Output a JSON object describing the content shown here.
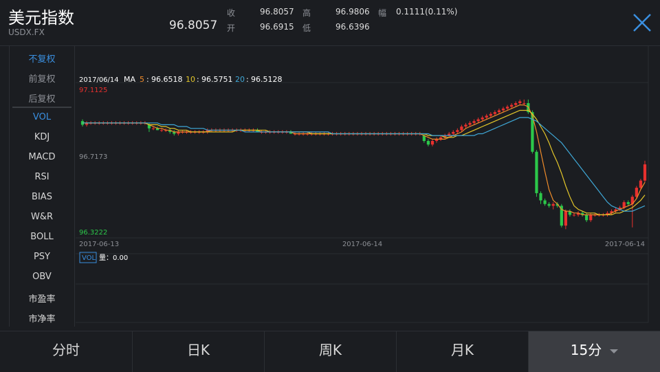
{
  "header": {
    "title": "美元指数",
    "code": "USDX.FX",
    "price": "96.8057",
    "quotes": [
      {
        "label": "收",
        "value": "96.8057"
      },
      {
        "label": "开",
        "value": "96.6915"
      },
      {
        "label": "高",
        "value": "96.9806"
      },
      {
        "label": "低",
        "value": "96.6396"
      },
      {
        "label": "幅",
        "value": "0.1111(0.11%)"
      }
    ]
  },
  "sidebar": {
    "adjust": [
      "不复权",
      "前复权",
      "后复权"
    ],
    "indicators": [
      "VOL",
      "KDJ",
      "MACD",
      "RSI",
      "BIAS",
      "W&R",
      "BOLL",
      "PSY",
      "OBV",
      "市盈率",
      "市净率"
    ]
  },
  "ma_legend": {
    "date": "2017/06/14",
    "label": "MA",
    "items": [
      {
        "key": "5",
        "value": "96.6518",
        "color": "#f08c2a"
      },
      {
        "key": "10",
        "value": "96.5751",
        "color": "#e4c72a"
      },
      {
        "key": "20",
        "value": "96.5128",
        "color": "#3fa7d6"
      }
    ]
  },
  "vol_legend": {
    "tag": "VOL",
    "text": "量：0.00"
  },
  "tabs": [
    "分时",
    "日K",
    "周K",
    "月K",
    "15分"
  ],
  "colors": {
    "up": "#e8302e",
    "down": "#2cc84a",
    "ma5": "#f08c2a",
    "ma10": "#e4c72a",
    "ma20": "#3fa7d6",
    "accent": "#3a8fe0"
  },
  "chart_data": {
    "type": "candlestick",
    "y_axis_labels": [
      "97.1125",
      "96.7173",
      "96.3222"
    ],
    "x_axis_labels": [
      "2017-06-13",
      "2017-06-14",
      "2017-06-14"
    ],
    "ylim": [
      96.3222,
      97.1125
    ],
    "candles": [
      [
        96.94,
        96.95,
        96.91,
        96.92
      ],
      [
        96.92,
        96.94,
        96.91,
        96.93
      ],
      [
        96.93,
        96.94,
        96.92,
        96.93
      ],
      [
        96.93,
        96.94,
        96.92,
        96.93
      ],
      [
        96.93,
        96.94,
        96.92,
        96.93
      ],
      [
        96.93,
        96.94,
        96.92,
        96.93
      ],
      [
        96.93,
        96.94,
        96.92,
        96.93
      ],
      [
        96.93,
        96.94,
        96.92,
        96.93
      ],
      [
        96.93,
        96.94,
        96.92,
        96.93
      ],
      [
        96.93,
        96.94,
        96.92,
        96.93
      ],
      [
        96.93,
        96.94,
        96.92,
        96.93
      ],
      [
        96.93,
        96.94,
        96.92,
        96.93
      ],
      [
        96.93,
        96.94,
        96.92,
        96.93
      ],
      [
        96.93,
        96.94,
        96.92,
        96.93
      ],
      [
        96.93,
        96.94,
        96.92,
        96.93
      ],
      [
        96.93,
        96.94,
        96.92,
        96.93
      ],
      [
        96.92,
        96.93,
        96.88,
        96.9
      ],
      [
        96.9,
        96.91,
        96.89,
        96.9
      ],
      [
        96.9,
        96.91,
        96.89,
        96.89
      ],
      [
        96.89,
        96.9,
        96.88,
        96.89
      ],
      [
        96.89,
        96.9,
        96.88,
        96.89
      ],
      [
        96.89,
        96.9,
        96.87,
        96.88
      ],
      [
        96.88,
        96.89,
        96.86,
        96.87
      ],
      [
        96.87,
        96.89,
        96.86,
        96.88
      ],
      [
        96.88,
        96.89,
        96.87,
        96.88
      ],
      [
        96.88,
        96.89,
        96.87,
        96.88
      ],
      [
        96.88,
        96.89,
        96.87,
        96.88
      ],
      [
        96.88,
        96.89,
        96.87,
        96.88
      ],
      [
        96.88,
        96.89,
        96.87,
        96.88
      ],
      [
        96.88,
        96.89,
        96.87,
        96.88
      ],
      [
        96.88,
        96.9,
        96.87,
        96.89
      ],
      [
        96.89,
        96.9,
        96.88,
        96.89
      ],
      [
        96.89,
        96.9,
        96.88,
        96.89
      ],
      [
        96.89,
        96.9,
        96.88,
        96.89
      ],
      [
        96.89,
        96.9,
        96.88,
        96.89
      ],
      [
        96.89,
        96.9,
        96.88,
        96.89
      ],
      [
        96.89,
        96.9,
        96.88,
        96.89
      ],
      [
        96.89,
        96.9,
        96.88,
        96.89
      ],
      [
        96.89,
        96.9,
        96.88,
        96.89
      ],
      [
        96.89,
        96.9,
        96.88,
        96.89
      ],
      [
        96.89,
        96.9,
        96.88,
        96.89
      ],
      [
        96.89,
        96.9,
        96.88,
        96.89
      ],
      [
        96.89,
        96.9,
        96.88,
        96.88
      ],
      [
        96.88,
        96.89,
        96.87,
        96.88
      ],
      [
        96.88,
        96.89,
        96.87,
        96.88
      ],
      [
        96.88,
        96.89,
        96.87,
        96.88
      ],
      [
        96.88,
        96.89,
        96.87,
        96.88
      ],
      [
        96.88,
        96.89,
        96.87,
        96.88
      ],
      [
        96.88,
        96.89,
        96.87,
        96.88
      ],
      [
        96.88,
        96.89,
        96.87,
        96.88
      ],
      [
        96.88,
        96.89,
        96.87,
        96.87
      ],
      [
        96.87,
        96.88,
        96.86,
        96.87
      ],
      [
        96.87,
        96.88,
        96.86,
        96.87
      ],
      [
        96.87,
        96.88,
        96.86,
        96.87
      ],
      [
        96.87,
        96.88,
        96.86,
        96.87
      ],
      [
        96.87,
        96.88,
        96.86,
        96.87
      ],
      [
        96.87,
        96.88,
        96.86,
        96.87
      ],
      [
        96.87,
        96.88,
        96.86,
        96.87
      ],
      [
        96.87,
        96.88,
        96.86,
        96.87
      ],
      [
        96.87,
        96.88,
        96.86,
        96.87
      ],
      [
        96.87,
        96.88,
        96.86,
        96.87
      ],
      [
        96.87,
        96.88,
        96.86,
        96.87
      ],
      [
        96.87,
        96.88,
        96.86,
        96.87
      ],
      [
        96.87,
        96.88,
        96.86,
        96.87
      ],
      [
        96.87,
        96.88,
        96.86,
        96.87
      ],
      [
        96.87,
        96.88,
        96.86,
        96.87
      ],
      [
        96.87,
        96.88,
        96.86,
        96.87
      ],
      [
        96.87,
        96.88,
        96.86,
        96.87
      ],
      [
        96.87,
        96.88,
        96.86,
        96.87
      ],
      [
        96.87,
        96.88,
        96.86,
        96.87
      ],
      [
        96.87,
        96.88,
        96.86,
        96.87
      ],
      [
        96.87,
        96.88,
        96.86,
        96.87
      ],
      [
        96.87,
        96.88,
        96.86,
        96.87
      ],
      [
        96.87,
        96.88,
        96.86,
        96.87
      ],
      [
        96.87,
        96.88,
        96.86,
        96.87
      ],
      [
        96.87,
        96.88,
        96.86,
        96.87
      ],
      [
        96.87,
        96.88,
        96.86,
        96.87
      ],
      [
        96.87,
        96.88,
        96.86,
        96.87
      ],
      [
        96.87,
        96.88,
        96.86,
        96.87
      ],
      [
        96.87,
        96.88,
        96.86,
        96.87
      ],
      [
        96.87,
        96.88,
        96.86,
        96.87
      ],
      [
        96.87,
        96.88,
        96.86,
        96.87
      ],
      [
        96.86,
        96.87,
        96.82,
        96.83
      ],
      [
        96.83,
        96.84,
        96.8,
        96.81
      ],
      [
        96.81,
        96.84,
        96.8,
        96.83
      ],
      [
        96.83,
        96.85,
        96.82,
        96.84
      ],
      [
        96.84,
        96.86,
        96.83,
        96.85
      ],
      [
        96.85,
        96.87,
        96.84,
        96.86
      ],
      [
        96.86,
        96.88,
        96.85,
        96.87
      ],
      [
        96.87,
        96.89,
        96.86,
        96.88
      ],
      [
        96.88,
        96.9,
        96.87,
        96.89
      ],
      [
        96.89,
        96.92,
        96.88,
        96.91
      ],
      [
        96.91,
        96.93,
        96.9,
        96.92
      ],
      [
        96.92,
        96.94,
        96.91,
        96.93
      ],
      [
        96.93,
        96.95,
        96.92,
        96.94
      ],
      [
        96.94,
        96.96,
        96.93,
        96.95
      ],
      [
        96.95,
        96.97,
        96.94,
        96.96
      ],
      [
        96.96,
        96.98,
        96.95,
        96.97
      ],
      [
        96.97,
        96.99,
        96.96,
        96.98
      ],
      [
        96.98,
        97.0,
        96.97,
        96.99
      ],
      [
        96.99,
        97.01,
        96.98,
        97.0
      ],
      [
        97.0,
        97.02,
        96.99,
        97.01
      ],
      [
        97.01,
        97.03,
        97.0,
        97.02
      ],
      [
        97.02,
        97.04,
        97.01,
        97.03
      ],
      [
        97.03,
        97.05,
        97.02,
        97.04
      ],
      [
        97.04,
        97.06,
        97.03,
        97.05
      ],
      [
        97.04,
        97.06,
        97.03,
        97.04
      ],
      [
        97.04,
        97.06,
        96.98,
        96.99
      ],
      [
        96.99,
        97.0,
        96.76,
        96.77
      ],
      [
        96.77,
        96.78,
        96.52,
        96.54
      ],
      [
        96.54,
        96.55,
        96.48,
        96.5
      ],
      [
        96.5,
        96.51,
        96.47,
        96.48
      ],
      [
        96.48,
        96.49,
        96.46,
        96.47
      ],
      [
        96.47,
        96.49,
        96.45,
        96.48
      ],
      [
        96.48,
        96.49,
        96.46,
        96.47
      ],
      [
        96.47,
        96.48,
        96.35,
        96.36
      ],
      [
        96.36,
        96.45,
        96.34,
        96.44
      ],
      [
        96.44,
        96.45,
        96.41,
        96.42
      ],
      [
        96.42,
        96.43,
        96.41,
        96.42
      ],
      [
        96.42,
        96.44,
        96.41,
        96.43
      ],
      [
        96.43,
        96.44,
        96.41,
        96.42
      ],
      [
        96.42,
        96.43,
        96.38,
        96.39
      ],
      [
        96.39,
        96.43,
        96.38,
        96.42
      ],
      [
        96.42,
        96.43,
        96.41,
        96.42
      ],
      [
        96.42,
        96.43,
        96.41,
        96.42
      ],
      [
        96.42,
        96.43,
        96.41,
        96.42
      ],
      [
        96.42,
        96.44,
        96.41,
        96.43
      ],
      [
        96.43,
        96.45,
        96.42,
        96.44
      ],
      [
        96.44,
        96.46,
        96.43,
        96.45
      ],
      [
        96.45,
        96.47,
        96.44,
        96.46
      ],
      [
        96.46,
        96.5,
        96.45,
        96.49
      ],
      [
        96.49,
        96.5,
        96.47,
        96.48
      ],
      [
        96.48,
        96.53,
        96.35,
        96.52
      ],
      [
        96.52,
        96.58,
        96.51,
        96.57
      ],
      [
        96.57,
        96.62,
        96.56,
        96.61
      ],
      [
        96.61,
        96.72,
        96.6,
        96.7
      ]
    ],
    "ma_lines": [
      {
        "name": "MA5",
        "values": [
          96.93,
          96.93,
          96.93,
          96.93,
          96.93,
          96.93,
          96.93,
          96.93,
          96.93,
          96.93,
          96.93,
          96.93,
          96.93,
          96.93,
          96.93,
          96.93,
          96.92,
          96.91,
          96.9,
          96.9,
          96.89,
          96.89,
          96.88,
          96.88,
          96.88,
          96.88,
          96.88,
          96.88,
          96.88,
          96.88,
          96.88,
          96.89,
          96.89,
          96.89,
          96.89,
          96.89,
          96.89,
          96.89,
          96.89,
          96.89,
          96.89,
          96.89,
          96.89,
          96.88,
          96.88,
          96.88,
          96.88,
          96.88,
          96.88,
          96.88,
          96.88,
          96.87,
          96.87,
          96.87,
          96.87,
          96.87,
          96.87,
          96.87,
          96.87,
          96.87,
          96.87,
          96.87,
          96.87,
          96.87,
          96.87,
          96.87,
          96.87,
          96.87,
          96.87,
          96.87,
          96.87,
          96.87,
          96.87,
          96.87,
          96.87,
          96.87,
          96.87,
          96.87,
          96.87,
          96.87,
          96.87,
          96.87,
          96.86,
          96.85,
          96.84,
          96.84,
          96.84,
          96.84,
          96.85,
          96.86,
          96.87,
          96.88,
          96.9,
          96.91,
          96.92,
          96.93,
          96.94,
          96.95,
          96.96,
          96.97,
          96.98,
          96.99,
          97.0,
          97.01,
          97.02,
          97.03,
          97.03,
          97.02,
          96.97,
          96.88,
          96.77,
          96.66,
          96.56,
          96.5,
          96.48,
          96.45,
          96.44,
          96.44,
          96.43,
          96.43,
          96.42,
          96.42,
          96.42,
          96.42,
          96.42,
          96.42,
          96.42,
          96.43,
          96.44,
          96.45,
          96.46,
          96.47,
          96.48,
          96.51,
          96.56,
          96.6
        ]
      },
      {
        "name": "MA10",
        "values": [
          96.93,
          96.93,
          96.93,
          96.93,
          96.93,
          96.93,
          96.93,
          96.93,
          96.93,
          96.93,
          96.93,
          96.93,
          96.93,
          96.93,
          96.93,
          96.93,
          96.92,
          96.92,
          96.92,
          96.91,
          96.91,
          96.9,
          96.9,
          96.89,
          96.89,
          96.89,
          96.88,
          96.88,
          96.88,
          96.88,
          96.88,
          96.88,
          96.88,
          96.88,
          96.88,
          96.88,
          96.88,
          96.89,
          96.89,
          96.89,
          96.89,
          96.89,
          96.89,
          96.89,
          96.89,
          96.88,
          96.88,
          96.88,
          96.88,
          96.88,
          96.88,
          96.88,
          96.88,
          96.88,
          96.88,
          96.87,
          96.87,
          96.87,
          96.87,
          96.87,
          96.87,
          96.87,
          96.87,
          96.87,
          96.87,
          96.87,
          96.87,
          96.87,
          96.87,
          96.87,
          96.87,
          96.87,
          96.87,
          96.87,
          96.87,
          96.87,
          96.87,
          96.87,
          96.87,
          96.87,
          96.87,
          96.87,
          96.87,
          96.86,
          96.86,
          96.86,
          96.86,
          96.85,
          96.85,
          96.85,
          96.86,
          96.86,
          96.87,
          96.88,
          96.89,
          96.9,
          96.91,
          96.92,
          96.93,
          96.94,
          96.95,
          96.96,
          96.97,
          96.98,
          96.99,
          97.0,
          97.0,
          97.0,
          96.98,
          96.95,
          96.91,
          96.87,
          96.82,
          96.76,
          96.71,
          96.65,
          96.58,
          96.52,
          96.47,
          96.45,
          96.44,
          96.43,
          96.43,
          96.43,
          96.42,
          96.42,
          96.42,
          96.42,
          96.43,
          96.43,
          96.44,
          96.45,
          96.46,
          96.48,
          96.5,
          96.53
        ]
      },
      {
        "name": "MA20",
        "values": [
          96.93,
          96.93,
          96.93,
          96.93,
          96.93,
          96.93,
          96.93,
          96.93,
          96.93,
          96.93,
          96.93,
          96.93,
          96.93,
          96.93,
          96.93,
          96.93,
          96.93,
          96.93,
          96.93,
          96.92,
          96.92,
          96.92,
          96.92,
          96.91,
          96.91,
          96.91,
          96.9,
          96.9,
          96.9,
          96.9,
          96.89,
          96.89,
          96.89,
          96.89,
          96.89,
          96.89,
          96.89,
          96.89,
          96.89,
          96.88,
          96.88,
          96.88,
          96.88,
          96.88,
          96.88,
          96.88,
          96.88,
          96.88,
          96.88,
          96.88,
          96.88,
          96.88,
          96.88,
          96.88,
          96.88,
          96.88,
          96.88,
          96.88,
          96.88,
          96.88,
          96.87,
          96.87,
          96.87,
          96.87,
          96.87,
          96.87,
          96.87,
          96.87,
          96.87,
          96.87,
          96.87,
          96.87,
          96.87,
          96.87,
          96.87,
          96.87,
          96.87,
          96.87,
          96.87,
          96.87,
          96.87,
          96.87,
          96.87,
          96.87,
          96.86,
          96.86,
          96.86,
          96.86,
          96.86,
          96.86,
          96.86,
          96.86,
          96.86,
          96.86,
          96.86,
          96.87,
          96.87,
          96.88,
          96.89,
          96.9,
          96.91,
          96.92,
          96.93,
          96.94,
          96.95,
          96.96,
          96.96,
          96.96,
          96.95,
          96.94,
          96.92,
          96.9,
          96.88,
          96.86,
          96.84,
          96.82,
          96.79,
          96.76,
          96.73,
          96.7,
          96.67,
          96.64,
          96.61,
          96.58,
          96.55,
          96.52,
          96.49,
          96.47,
          96.46,
          96.45,
          96.44,
          96.44,
          96.44,
          96.45,
          96.46,
          96.47
        ]
      }
    ]
  }
}
